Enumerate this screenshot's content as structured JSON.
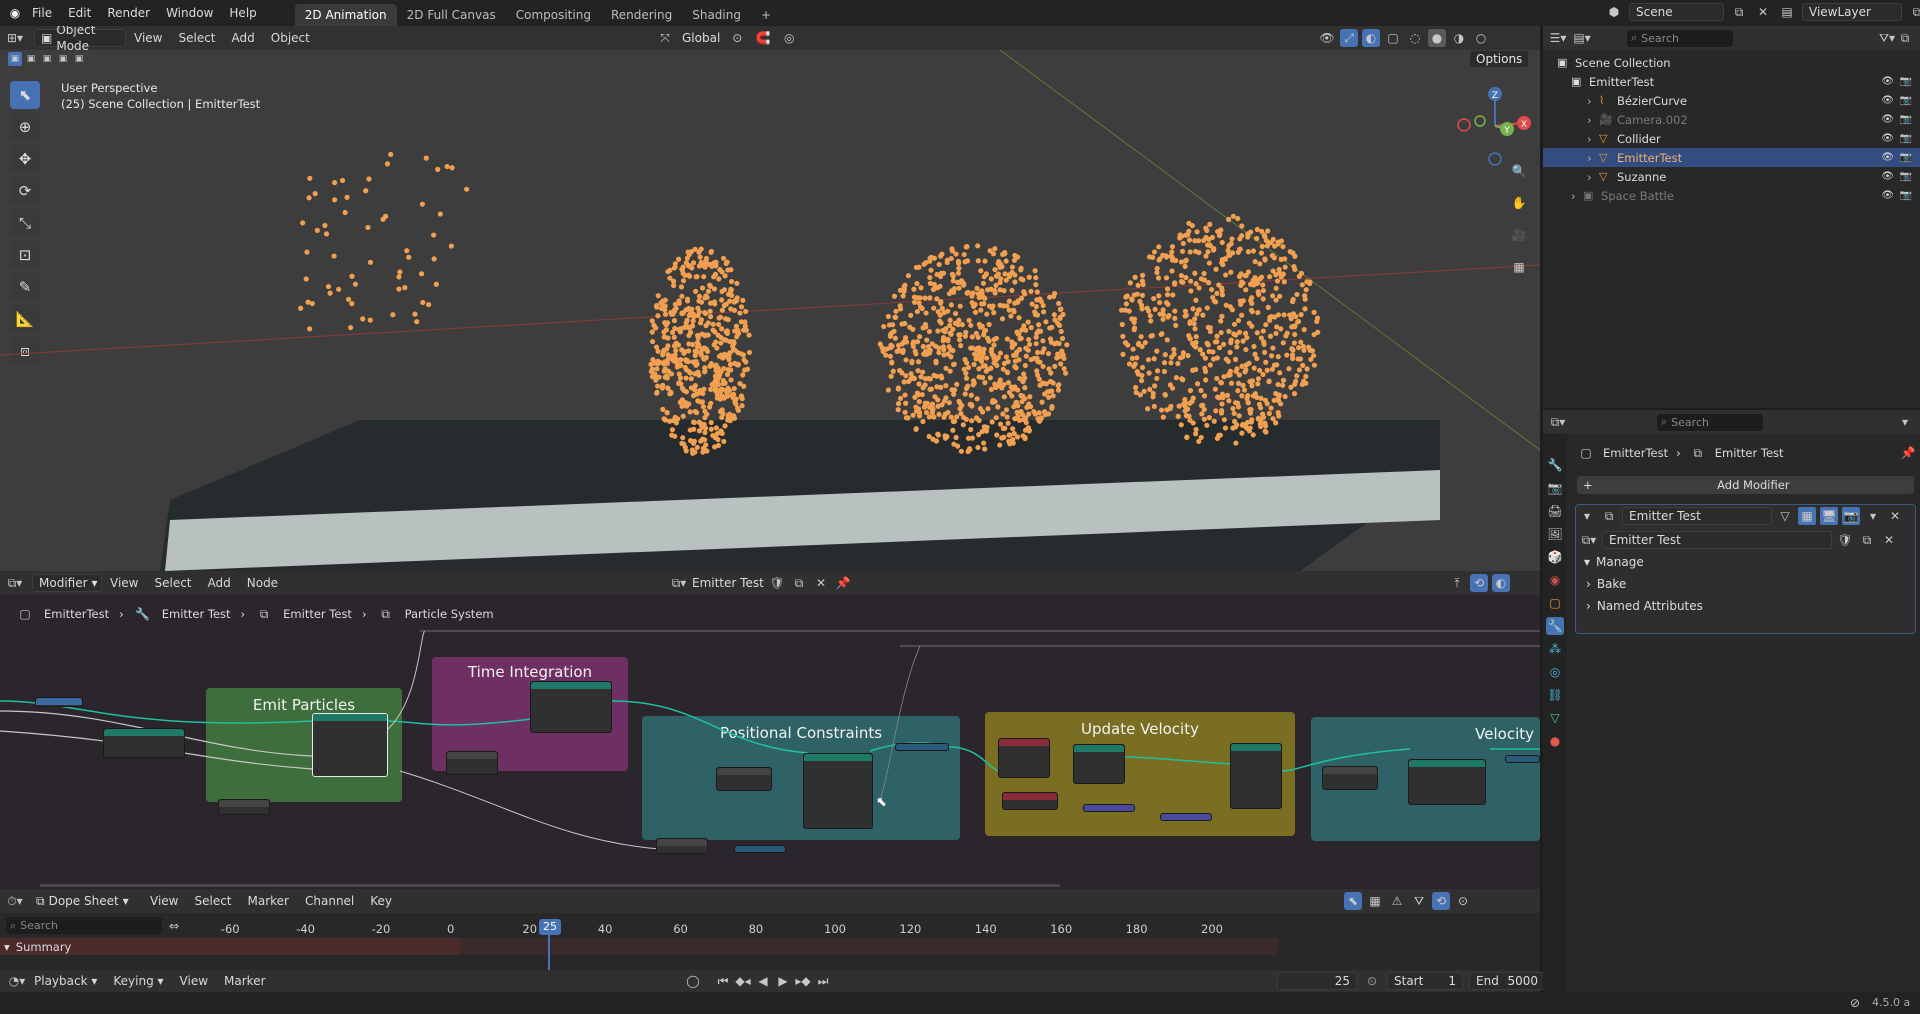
{
  "topbar": {
    "menus": [
      "File",
      "Edit",
      "Render",
      "Window",
      "Help"
    ],
    "workspaces": [
      "2D Animation",
      "2D Full Canvas",
      "Compositing",
      "Rendering",
      "Shading"
    ],
    "active_workspace": "2D Animation",
    "add_tab": "+",
    "scene": "Scene",
    "view_layer": "ViewLayer"
  },
  "viewport": {
    "mode": "Object Mode",
    "menus": [
      "View",
      "Select",
      "Add",
      "Object"
    ],
    "transform_orientation": "Global",
    "options": "Options",
    "overlay_line1": "User Perspective",
    "overlay_line2": "(25) Scene Collection | EmitterTest",
    "gizmo": {
      "x": "X",
      "y": "Y",
      "z": "Z"
    }
  },
  "outliner": {
    "search_placeholder": "Search",
    "items": [
      {
        "label": "Scene Collection",
        "active": false,
        "dim": false
      },
      {
        "label": "EmitterTest",
        "active": false,
        "dim": false
      },
      {
        "label": "BézierCurve",
        "active": false,
        "dim": false
      },
      {
        "label": "Camera.002",
        "active": false,
        "dim": true
      },
      {
        "label": "Collider",
        "active": false,
        "dim": false
      },
      {
        "label": "EmitterTest",
        "active": true,
        "dim": false
      },
      {
        "label": "Suzanne",
        "active": false,
        "dim": false
      },
      {
        "label": "Space Battle",
        "active": false,
        "dim": true
      }
    ]
  },
  "properties": {
    "search_placeholder": "Search",
    "breadcrumb": [
      "EmitterTest",
      "Emitter Test"
    ],
    "add_modifier": "Add Modifier",
    "modifier_name": "Emitter Test",
    "node_group": "Emitter Test",
    "panels": [
      "Manage",
      "Bake",
      "Named Attributes"
    ]
  },
  "node_editor": {
    "editor_type": "Modifier",
    "menus": [
      "View",
      "Select",
      "Add",
      "Node"
    ],
    "node_group": "Emitter Test",
    "breadcrumb": [
      "EmitterTest",
      "Emitter Test",
      "Emitter Test",
      "Particle System"
    ],
    "frames": [
      "Emit Particles",
      "Time Integration",
      "Positional Constraints",
      "Update Velocity",
      "Velocity"
    ]
  },
  "dopesheet": {
    "mode": "Dope Sheet",
    "menus": [
      "View",
      "Select",
      "Marker",
      "Channel",
      "Key"
    ],
    "search_placeholder": "Search",
    "summary": "Summary",
    "ticks": [
      "-60",
      "-40",
      "-20",
      "0",
      "20",
      "40",
      "60",
      "80",
      "100",
      "120",
      "140",
      "160",
      "180",
      "200"
    ],
    "current_frame": "25"
  },
  "timeline": {
    "menus": [
      "Playback",
      "Keying",
      "View",
      "Marker"
    ],
    "frame": "25",
    "start_label": "Start",
    "start": "1",
    "end_label": "End",
    "end": "5000"
  },
  "status": {
    "version": "4.5.0 a"
  },
  "colors": {
    "accent": "#4772b3",
    "particle": "#f0a050",
    "frame_emit": "#3d6e3b",
    "frame_time": "#6e2f63",
    "frame_pos": "#2f6266",
    "frame_vel": "#7a6e22"
  }
}
